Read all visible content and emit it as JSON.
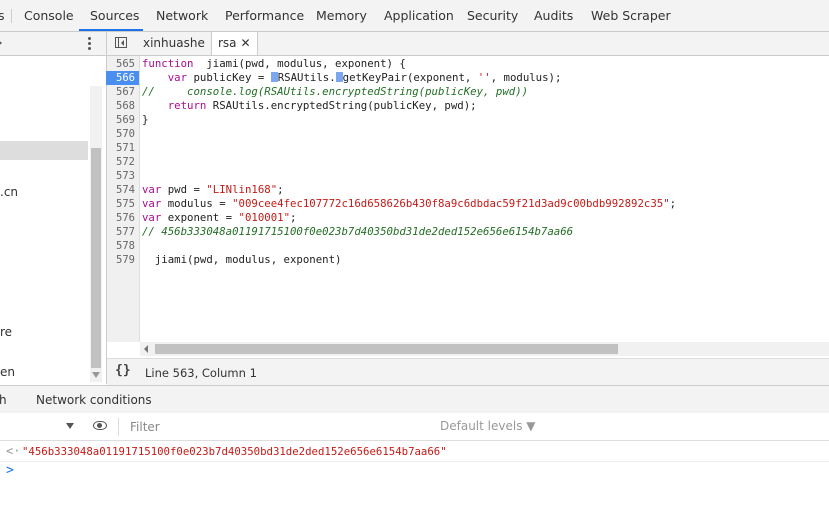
{
  "top_tabs": [
    {
      "label": "Console"
    },
    {
      "label": "Sources"
    },
    {
      "label": "Network"
    },
    {
      "label": "Performance"
    },
    {
      "label": "Memory"
    },
    {
      "label": "Application"
    },
    {
      "label": "Security"
    },
    {
      "label": "Audits"
    },
    {
      "label": "Web Scraper"
    }
  ],
  "active_top_tab": "Sources",
  "navigator": {
    "items": [
      ".cn",
      "re",
      "en"
    ]
  },
  "editor_tabs": [
    {
      "label": "xinhuashe"
    },
    {
      "label": "rsa",
      "close": "✕"
    }
  ],
  "code": {
    "line_numbers": [
      "565",
      "566",
      "567",
      "568",
      "569",
      "570",
      "571",
      "572",
      "573",
      "574",
      "575",
      "576",
      "577",
      "578",
      "579"
    ],
    "breakpoint_line": "566",
    "lines": [
      {
        "parts": [
          [
            "kw",
            "function"
          ],
          [
            "",
            "  jiami(pwd, modulus, exponent) {"
          ]
        ]
      },
      {
        "parts": [
          [
            "",
            "    "
          ],
          [
            "kw",
            "var"
          ],
          [
            "",
            " publicKey = "
          ],
          [
            "mk",
            ""
          ],
          [
            "",
            "RSAUtils."
          ],
          [
            "mk",
            ""
          ],
          [
            "",
            "getKeyPair(exponent, "
          ],
          [
            "str",
            "''"
          ],
          [
            "",
            ", modulus);"
          ]
        ]
      },
      {
        "parts": [
          [
            "cm",
            "//     console.log(RSAUtils.encryptedString(publicKey, pwd))"
          ]
        ]
      },
      {
        "parts": [
          [
            "",
            "    "
          ],
          [
            "kw",
            "return"
          ],
          [
            "",
            " RSAUtils.encryptedString(publicKey, pwd);"
          ]
        ]
      },
      {
        "parts": [
          [
            "",
            "}"
          ]
        ]
      },
      {
        "parts": []
      },
      {
        "parts": []
      },
      {
        "parts": []
      },
      {
        "parts": []
      },
      {
        "parts": [
          [
            "kw",
            "var"
          ],
          [
            "",
            " pwd = "
          ],
          [
            "str",
            "\"LINlin168\""
          ],
          [
            "",
            ";"
          ]
        ]
      },
      {
        "parts": [
          [
            "kw",
            "var"
          ],
          [
            "",
            " modulus = "
          ],
          [
            "str",
            "\"009cee4fec107772c16d658626b430f8a9c6dbdac59f21d3ad9c00bdb992892c35\""
          ],
          [
            "",
            ";"
          ]
        ]
      },
      {
        "parts": [
          [
            "kw",
            "var"
          ],
          [
            "",
            " exponent = "
          ],
          [
            "str",
            "\"010001\""
          ],
          [
            "",
            ";"
          ]
        ]
      },
      {
        "parts": [
          [
            "cm",
            "// 456b333048a01191715100f0e023b7d40350bd31de2ded152e656e6154b7aa66"
          ]
        ]
      },
      {
        "parts": []
      },
      {
        "parts": [
          [
            "",
            ""
          ],
          [
            "",
            "  jiami(pwd, modulus, exponent)"
          ]
        ]
      }
    ]
  },
  "status": {
    "braces": "{}",
    "position": "Line 563, Column 1"
  },
  "drawer": {
    "tabs": [
      "h",
      "Network conditions"
    ]
  },
  "console": {
    "filter_placeholder": "Filter",
    "levels": "Default levels ▼",
    "result_arrow": "<·",
    "result": "\"456b333048a01191715100f0e023b7d40350bd31de2ded152e656e6154b7aa66\"",
    "prompt": ">"
  },
  "colors": {
    "accent": "#1a73e8",
    "breakpoint": "#4a8ef0",
    "keyword": "#aa0d91",
    "string": "#c41a16",
    "comment": "#236e25"
  }
}
